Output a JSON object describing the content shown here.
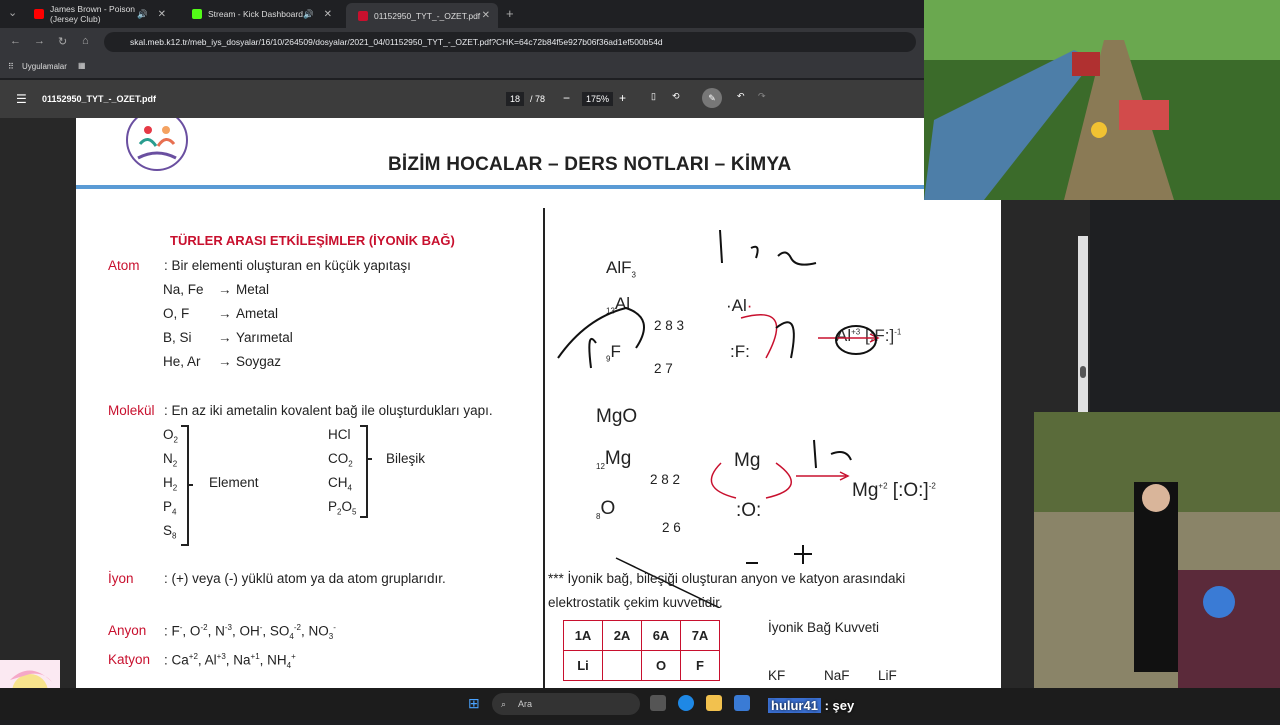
{
  "browser": {
    "tabs": [
      {
        "label": "James Brown - Poison (Jersey Club)",
        "favicon_color": "#ff0000",
        "active": false
      },
      {
        "label": "Stream - Kick Dashboard",
        "favicon_color": "#53fc18",
        "active": false
      },
      {
        "label": "01152950_TYT_-_OZET.pdf",
        "favicon_color": "#c8102e",
        "active": true
      }
    ],
    "new_tab": "+",
    "url": "skal.meb.k12.tr/meb_iys_dosyalar/16/10/264509/dosyalar/2021_04/01152950_TYT_-_OZET.pdf?CHK=64c72b84f5e927b06f36ad1ef500b54d",
    "bookmarks_label": "Uygulamalar"
  },
  "pdf_toolbar": {
    "filename": "01152950_TYT_-_OZET.pdf",
    "page_current": "18",
    "page_total": "/ 78",
    "zoom": "175%",
    "zoom_out": "−",
    "zoom_in": "+"
  },
  "page": {
    "header": "BİZİM HOCALAR – DERS NOTLARI – KİMYA",
    "left": {
      "section_title": "TÜRLER ARASI ETKİLEŞİMLER (İYONİK BAĞ)",
      "atom_label": "Atom",
      "atom_def": ": Bir elementi oluşturan en küçük yapıtaşı",
      "atom_examples": [
        {
          "elems": "Na, Fe",
          "type": "Metal"
        },
        {
          "elems": "O, F",
          "type": "Ametal"
        },
        {
          "elems": "B, Si",
          "type": "Yarımetal"
        },
        {
          "elems": "He, Ar",
          "type": "Soygaz"
        }
      ],
      "arrow": "→",
      "molekul_label": "Molekül",
      "molekul_def": ": En az iki ametalin kovalent bağ ile oluşturdukları yapı.",
      "element_group_label": "Element",
      "compound_group_label": "Bileşik",
      "iyon_label": "İyon",
      "iyon_def": ": (+) veya (-) yüklü atom ya da atom gruplarıdır.",
      "anyon_label": "Anyon",
      "katyon_label": "Katyon"
    },
    "right": {
      "alf3": "AlF",
      "mgo": "MgO",
      "al_shells": "2  8  3",
      "f_shells": "2  7",
      "mg_shells": "2  8  2",
      "o_shells": "2  6",
      "al_product": "Al",
      "mg_product": "Mg",
      "note": "*** İyonik bağ, bileşiği oluşturan anyon ve katyon arasındaki",
      "note2": "elektrostatik çekim kuvvetidir.",
      "table_header": [
        "1A",
        "2A",
        "6A",
        "7A"
      ],
      "table_row": [
        "Li",
        "",
        "O",
        "F"
      ],
      "bond_strength_title": "İyonik Bağ Kuvveti",
      "compounds": [
        "KF",
        "NaF",
        "LiF"
      ]
    }
  },
  "taskbar": {
    "search_placeholder": "Ara"
  },
  "chat": {
    "user": "hulur41",
    "message": ": şey"
  },
  "colors": {
    "accent_red": "#c8102e",
    "header_blue": "#5a9bd5"
  }
}
